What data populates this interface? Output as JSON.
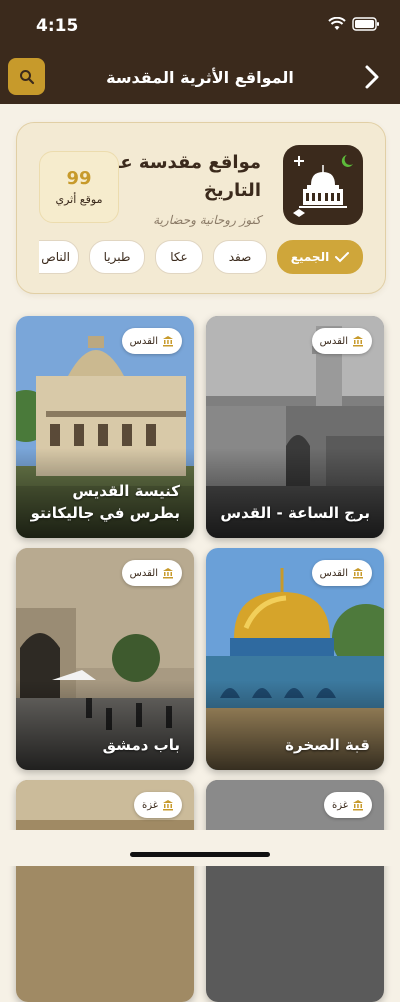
{
  "status": {
    "time": "4:15"
  },
  "nav": {
    "title": "المواقع الأثرية المقدسة"
  },
  "hero": {
    "title": "مواقع مقدسة عبر التاريخ",
    "subtitle": "كنوز روحانية وحضارية",
    "count": "99",
    "count_label": "موقع أثري"
  },
  "filters": [
    {
      "label": "الجميع",
      "active": true
    },
    {
      "label": "صفد"
    },
    {
      "label": "عكا"
    },
    {
      "label": "طبريا"
    },
    {
      "label": "الناص"
    }
  ],
  "sites": [
    {
      "title": "برج الساعة - القدس",
      "badge": "القدس"
    },
    {
      "title": "كنيسة القديس بطرس في جاليكانتو",
      "badge": "القدس"
    },
    {
      "title": "قبة الصخرة",
      "badge": "القدس"
    },
    {
      "title": "باب دمشق",
      "badge": "القدس"
    },
    {
      "title": "",
      "badge": "غزة"
    },
    {
      "title": "",
      "badge": "غزة"
    }
  ],
  "colors": {
    "brown": "#3b2a1c",
    "gold": "#c79a2b",
    "background": "#f6f1e6"
  }
}
